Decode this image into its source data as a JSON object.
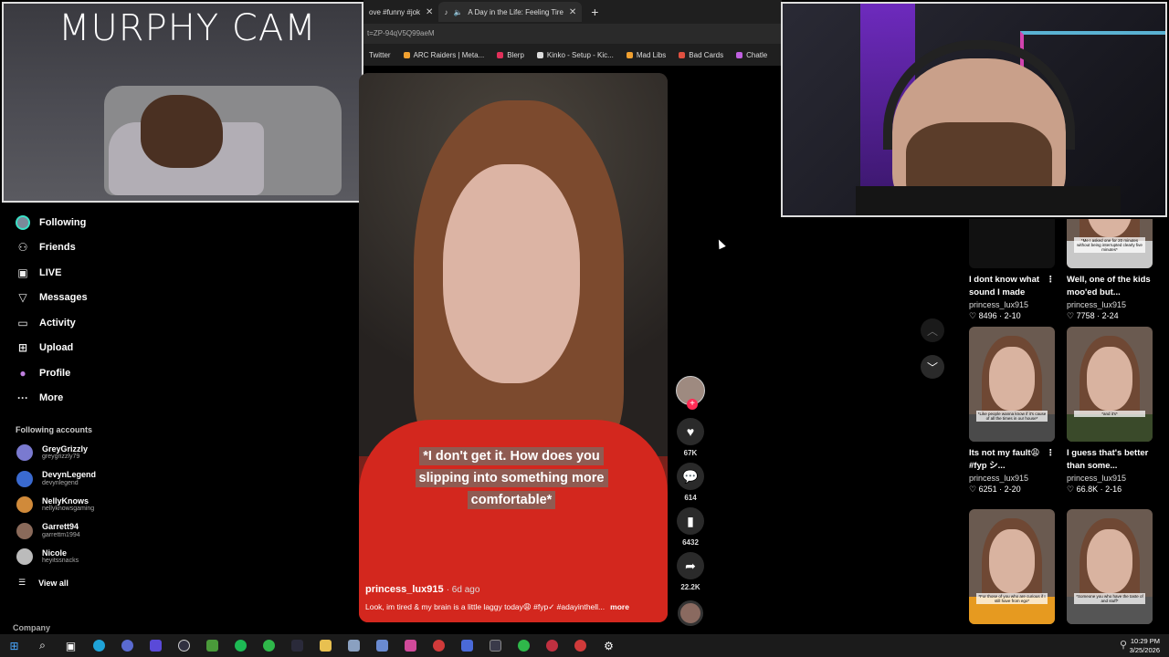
{
  "browser": {
    "tabs": [
      {
        "label": "ove #funny #jok"
      },
      {
        "label": "A Day in the Life: Feeling Tire"
      }
    ],
    "address": "t=ZP-94qV5Q99aeM",
    "bookmarks": [
      {
        "label": "Twitter",
        "color": "#ffffff"
      },
      {
        "label": "ARC Raiders | Meta...",
        "color": "#f0a030"
      },
      {
        "label": "Blerp",
        "color": "#e0305a"
      },
      {
        "label": "Kinko - Setup - Kic...",
        "color": "#dddddd"
      },
      {
        "label": "Mad Libs",
        "color": "#f0a030"
      },
      {
        "label": "Bad Cards",
        "color": "#e05040"
      },
      {
        "label": "Chatle",
        "color": "#c060e0"
      }
    ]
  },
  "cam_left": {
    "title": "MURPHY CAM"
  },
  "sidebar": {
    "nav": [
      {
        "label": "Following",
        "icon": "avatar"
      },
      {
        "label": "Friends",
        "icon": "people-icon",
        "glyph": "⚇"
      },
      {
        "label": "LIVE",
        "icon": "live-icon",
        "glyph": "▣"
      },
      {
        "label": "Messages",
        "icon": "messages-icon",
        "glyph": "▽"
      },
      {
        "label": "Activity",
        "icon": "activity-icon",
        "glyph": "▭"
      },
      {
        "label": "Upload",
        "icon": "upload-icon",
        "glyph": "⊞"
      },
      {
        "label": "Profile",
        "icon": "profile-icon",
        "glyph": "●"
      },
      {
        "label": "More",
        "icon": "more-icon",
        "glyph": "···"
      }
    ],
    "following_label": "Following accounts",
    "accounts": [
      {
        "name": "GreyGrizzly",
        "handle": "greygrizzly79",
        "color": "#7a7ad0"
      },
      {
        "name": "DevynLegend",
        "handle": "devynlegend",
        "color": "#3a6ad0"
      },
      {
        "name": "NellyKnows",
        "handle": "nellyknowsgaming",
        "color": "#d08a3a"
      },
      {
        "name": "Garrett94",
        "handle": "garrettm1994",
        "color": "#8a6a5a"
      },
      {
        "name": "Nicole",
        "handle": "heyitssnacks",
        "color": "#bbbbbb"
      }
    ],
    "view_all": "View all",
    "company": "Company"
  },
  "video": {
    "caption": "*I don't get it. How does you slipping into something more comfortable*",
    "username": "princess_lux915",
    "ago": "· 6d ago",
    "description": "Look, im tired & my brain is a little laggy today😩 #fyp✓ #adayinthell...",
    "more": "more",
    "counts": {
      "likes": "67K",
      "comments": "614",
      "saves": "6432",
      "shares": "22.2K"
    }
  },
  "grid": [
    {
      "title": "I dont know what sound I made but...",
      "author": "princess_lux915",
      "likes": "8496",
      "date": "2-10",
      "shirt": "#2a2a2a",
      "cap": ""
    },
    {
      "title": "Well, one of the kids moo'ed but...",
      "author": "princess_lux915",
      "likes": "7758",
      "date": "2-24",
      "shirt": "#c8c8c8",
      "cap": "*Me I asked one for 20 minutes without being interrupted clearly five minutes*"
    },
    {
      "title": "Its not my fault😩 #fyp シ...",
      "author": "princess_lux915",
      "likes": "6251",
      "date": "2-20",
      "shirt": "#4a4a4a",
      "cap": "*Like people wanna know if it's cause of all the times in our house*"
    },
    {
      "title": "I guess that's better than some...",
      "author": "princess_lux915",
      "likes": "66.8K",
      "date": "2-16",
      "shirt": "#3a4a2a",
      "cap": "*and it's*"
    },
    {
      "title": "",
      "author": "",
      "likes": "",
      "date": "",
      "shirt": "#e69a20",
      "cap": "*For those of you who are curious if I still have from ego*"
    },
    {
      "title": "",
      "author": "",
      "likes": "",
      "date": "",
      "shirt": "#555555",
      "cap": "*Someone you who have the taste of and stuff*"
    }
  ],
  "taskbar": {
    "time": "10:29 PM",
    "date": "3/25/2026"
  }
}
